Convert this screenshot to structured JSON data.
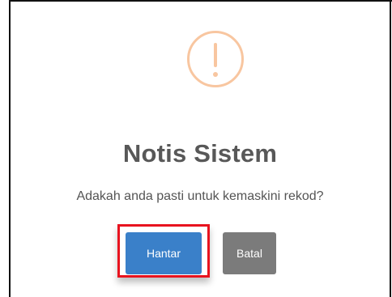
{
  "dialog": {
    "icon": "warning-icon",
    "title": "Notis Sistem",
    "message": "Adakah anda pasti untuk kemaskini rekod?",
    "buttons": {
      "submit_label": "Hantar",
      "cancel_label": "Batal"
    }
  },
  "colors": {
    "icon_ring": "#f8c6a0",
    "title": "#585858",
    "submit": "#3a80c9",
    "cancel": "#7b7b7b",
    "highlight": "#e8131f"
  }
}
